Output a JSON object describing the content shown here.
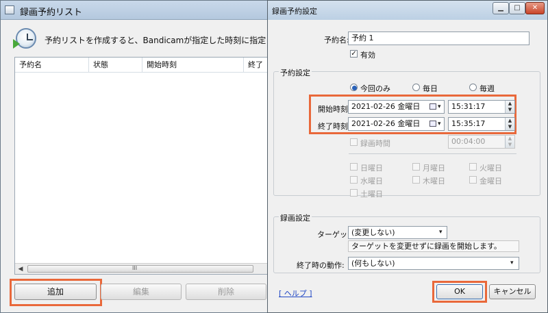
{
  "back_window": {
    "title": "録画予約リスト",
    "description": "予約リストを作成すると、Bandicamが指定した時刻に指定したタ",
    "columns": [
      "予約名",
      "状態",
      "開始時刻",
      "終了"
    ],
    "scroll_indicator": "III",
    "buttons": {
      "add": "追加",
      "edit": "編集",
      "delete": "削除"
    }
  },
  "dialog": {
    "title": "録画予約設定",
    "window_buttons": {
      "minimize": "▁",
      "maximize": "□",
      "close": "✕"
    },
    "name_label": "予約名:",
    "name_value": "予約 1",
    "enabled_label": "有効",
    "schedule_group": "予約設定",
    "repeat_options": [
      "今回のみ",
      "毎日",
      "毎週"
    ],
    "start_label": "開始時刻:",
    "start_date": "2021-02-26 金曜日",
    "start_time": "15:31:17",
    "end_label": "終了時刻:",
    "end_date": "2021-02-26 金曜日",
    "end_time": "15:35:17",
    "duration_label": "録画時間",
    "duration_value": "00:04:00",
    "weekdays": [
      "日曜日",
      "月曜日",
      "火曜日",
      "水曜日",
      "木曜日",
      "金曜日",
      "土曜日"
    ],
    "recording_group": "録画設定",
    "target_label": "ターゲット:",
    "target_value": "(変更しない)",
    "target_note": "ターゲットを変更せずに録画を開始します。",
    "after_label": "終了時の動作:",
    "after_value": "(何もしない)",
    "help_link": "[ ヘルプ ]",
    "ok": "OK",
    "cancel": "キャンセル"
  },
  "colors": {
    "highlight": "#e9683a",
    "link": "#2047c4"
  }
}
